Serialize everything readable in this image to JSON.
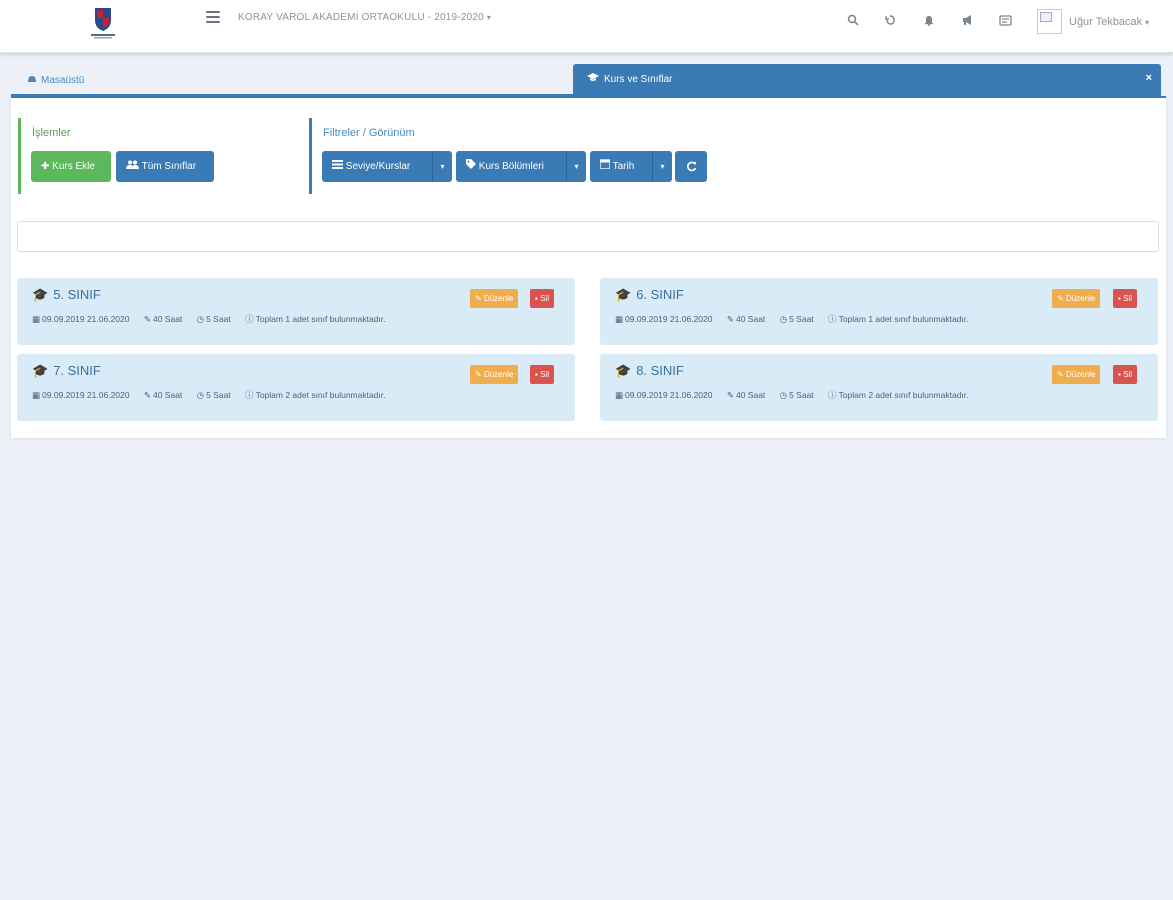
{
  "header": {
    "school": "KORAY VAROL AKADEMİ ORTAOKULU - 2019-2020",
    "user_name": "Uğur Tekbacak",
    "icons": [
      "search-icon",
      "history-icon",
      "bell-icon",
      "megaphone-icon",
      "card-icon"
    ]
  },
  "tabs": {
    "home_label": "Masaüstü",
    "active_label": "Kurs ve Sınıflar",
    "close_symbol": "×"
  },
  "operations": {
    "title": "İşlemler",
    "add_course": "Kurs Ekle",
    "all_classes": "Tüm Sınıflar"
  },
  "filters": {
    "title": "Filtreler / Görünüm",
    "levels": "Seviye/Kurslar",
    "sections": "Kurs Bölümleri",
    "date": "Tarih"
  },
  "cards": [
    {
      "title": "5. SINIF",
      "dates": "09.09.2019 21.06.2020",
      "hours": "40 Saat",
      "weekly": "5 Saat",
      "info": "Toplam 1 adet sınıf bulunmaktadır.",
      "edit": "Düzenle",
      "delete": "Sil"
    },
    {
      "title": "6. SINIF",
      "dates": "09.09.2019 21.06.2020",
      "hours": "40 Saat",
      "weekly": "5 Saat",
      "info": "Toplam 1 adet sınıf bulunmaktadır.",
      "edit": "Düzenle",
      "delete": "Sil"
    },
    {
      "title": "7. SINIF",
      "dates": "09.09.2019 21.06.2020",
      "hours": "40 Saat",
      "weekly": "5 Saat",
      "info": "Toplam 2 adet sınıf bulunmaktadır.",
      "edit": "Düzenle",
      "delete": "Sil"
    },
    {
      "title": "8. SINIF",
      "dates": "09.09.2019 21.06.2020",
      "hours": "40 Saat",
      "weekly": "5 Saat",
      "info": "Toplam 2 adet sınıf bulunmaktadır.",
      "edit": "Düzenle",
      "delete": "Sil"
    }
  ],
  "colors": {
    "primary": "#3a7ab5",
    "success": "#5cb85c",
    "warning": "#f0ad4e",
    "danger": "#d9534f",
    "card_bg": "#d9ebf7"
  }
}
